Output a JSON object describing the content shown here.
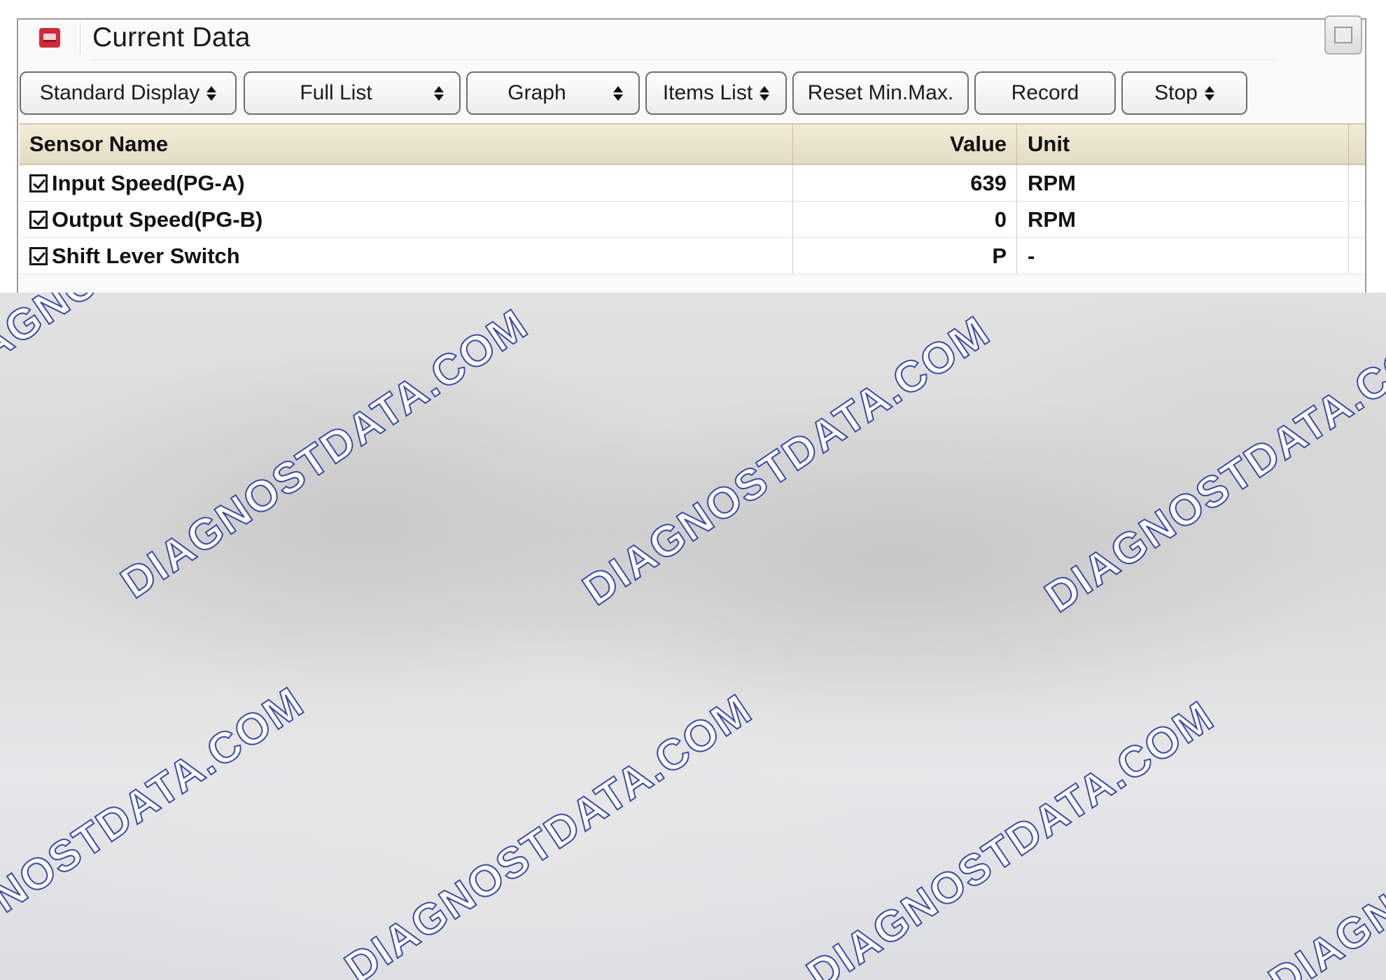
{
  "window": {
    "title": "Current Data",
    "icon": "scanner-app-icon"
  },
  "toolbar": {
    "standard_display": "Standard Display",
    "full_list": "Full List",
    "graph": "Graph",
    "items_list": "Items List",
    "reset_min_max": "Reset Min.Max.",
    "record": "Record",
    "stop": "Stop"
  },
  "table": {
    "headers": {
      "name": "Sensor Name",
      "value": "Value",
      "unit": "Unit"
    },
    "rows": [
      {
        "name": "Input Speed(PG-A)",
        "value": "639",
        "unit": "RPM",
        "checked": true
      },
      {
        "name": "Output Speed(PG-B)",
        "value": "0",
        "unit": "RPM",
        "checked": true
      },
      {
        "name": "Shift Lever Switch",
        "value": "P",
        "unit": "-",
        "checked": true
      }
    ]
  },
  "watermark": {
    "text": "DIAGNOSTDATA.COM",
    "color": "#3b4aa8"
  }
}
